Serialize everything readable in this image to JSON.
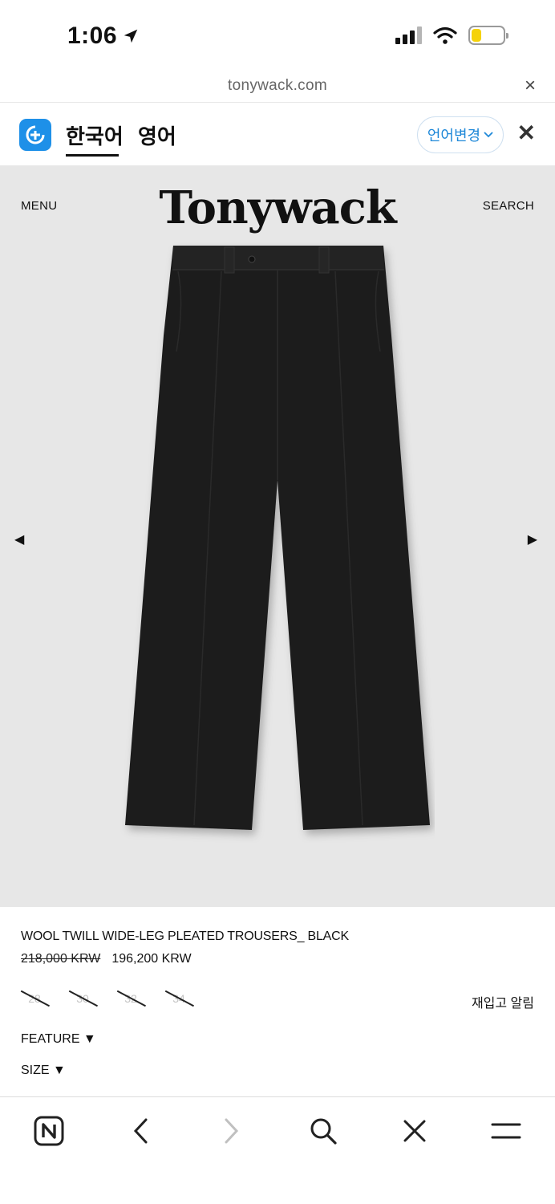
{
  "status": {
    "time": "1:06"
  },
  "browser": {
    "url": "tonywack.com"
  },
  "translate": {
    "active_lang": "한국어",
    "other_lang": "영어",
    "change_label": "언어변경"
  },
  "site": {
    "brand": "Tonywack",
    "menu": "MENU",
    "search": "SEARCH"
  },
  "product": {
    "name": "WOOL TWILL WIDE-LEG PLEATED TROUSERS_ BLACK",
    "original_price": "218,000 KRW",
    "sale_price": "196,200 KRW",
    "sizes": [
      "28",
      "30",
      "32",
      "34"
    ],
    "restock_label": "재입고 알림",
    "feature_label": "FEATURE ▼",
    "size_label": "SIZE ▼"
  },
  "icons": {
    "prev": "arrow-left-icon",
    "next": "arrow-right-icon",
    "colors": {
      "accent": "#1e88d8",
      "hero_bg": "#e7e7e7",
      "battery": "#f5d20a"
    }
  }
}
